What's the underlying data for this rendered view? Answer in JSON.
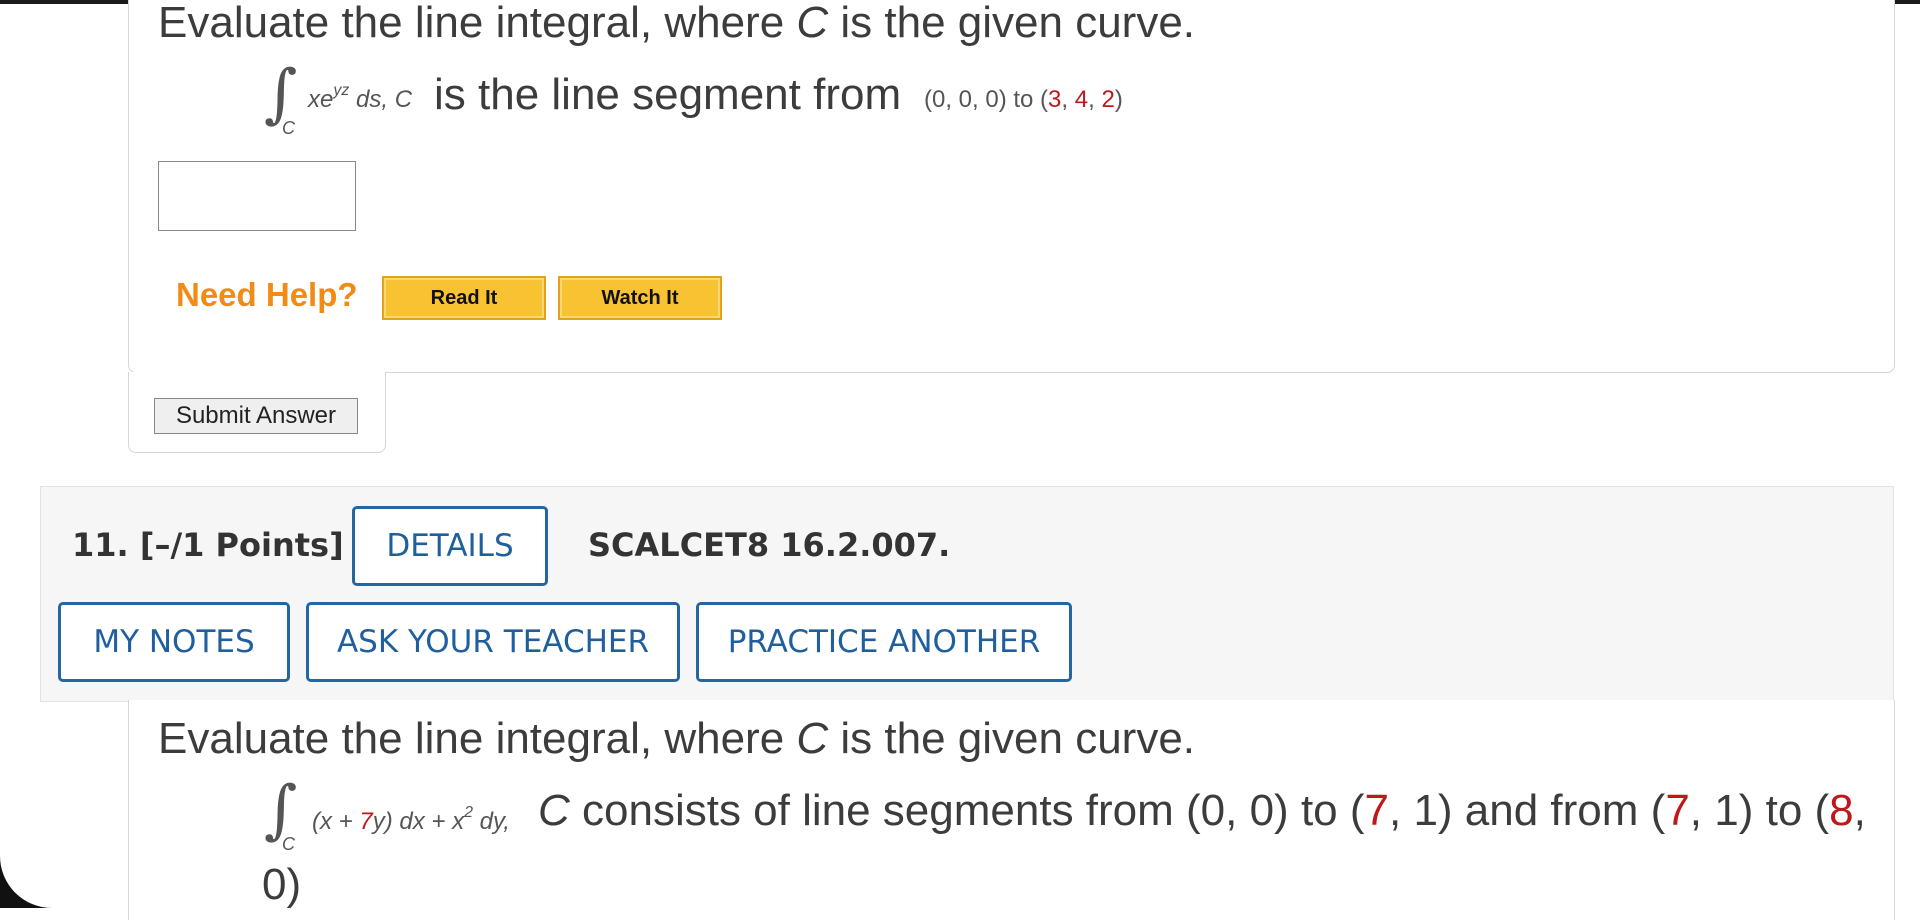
{
  "question10": {
    "prompt_pre": "Evaluate the line integral, where ",
    "prompt_var": "C",
    "prompt_post": " is the given curve.",
    "integral_sub": "C",
    "integrand_x": "xe",
    "integrand_exp": "yz",
    "integrand_ds": " ds, C",
    "curve_text": "is the line segment from",
    "from_point": "(0, 0, 0) to (",
    "to_x": "3",
    "sep1": ", ",
    "to_y": "4",
    "sep2": ", ",
    "to_z": "2",
    "close": ")",
    "answer_value": "",
    "need_help_label": "Need Help?",
    "read_it_label": "Read It",
    "watch_it_label": "Watch It",
    "submit_label": "Submit Answer"
  },
  "question11": {
    "number_points": "11.  [–/1 Points]",
    "details_label": "DETAILS",
    "reference": "SCALCET8 16.2.007.",
    "my_notes_label": "MY NOTES",
    "ask_teacher_label": "ASK YOUR TEACHER",
    "practice_label": "PRACTICE ANOTHER",
    "prompt_pre": "Evaluate the line integral, where ",
    "prompt_var": "C",
    "prompt_post": " is the given curve.",
    "integral_sub": "C",
    "integrand_a": "(x + ",
    "integrand_coef": "7",
    "integrand_b": "y) dx + x",
    "integrand_exp": "2",
    "integrand_c": " dy,",
    "curve_var": "C",
    "curve_a": " consists of line segments from (0, 0) to (",
    "p1": "7",
    "curve_b": ", 1) and from (",
    "p2": "7",
    "curve_c": ", 1) to (",
    "p3": "8",
    "curve_d": ",",
    "curve_wrap": "0)"
  },
  "colors": {
    "accent_blue": "#1f5f9e",
    "help_orange": "#f08c16",
    "button_yellow": "#f9c232",
    "highlight_red": "#c0171a"
  }
}
